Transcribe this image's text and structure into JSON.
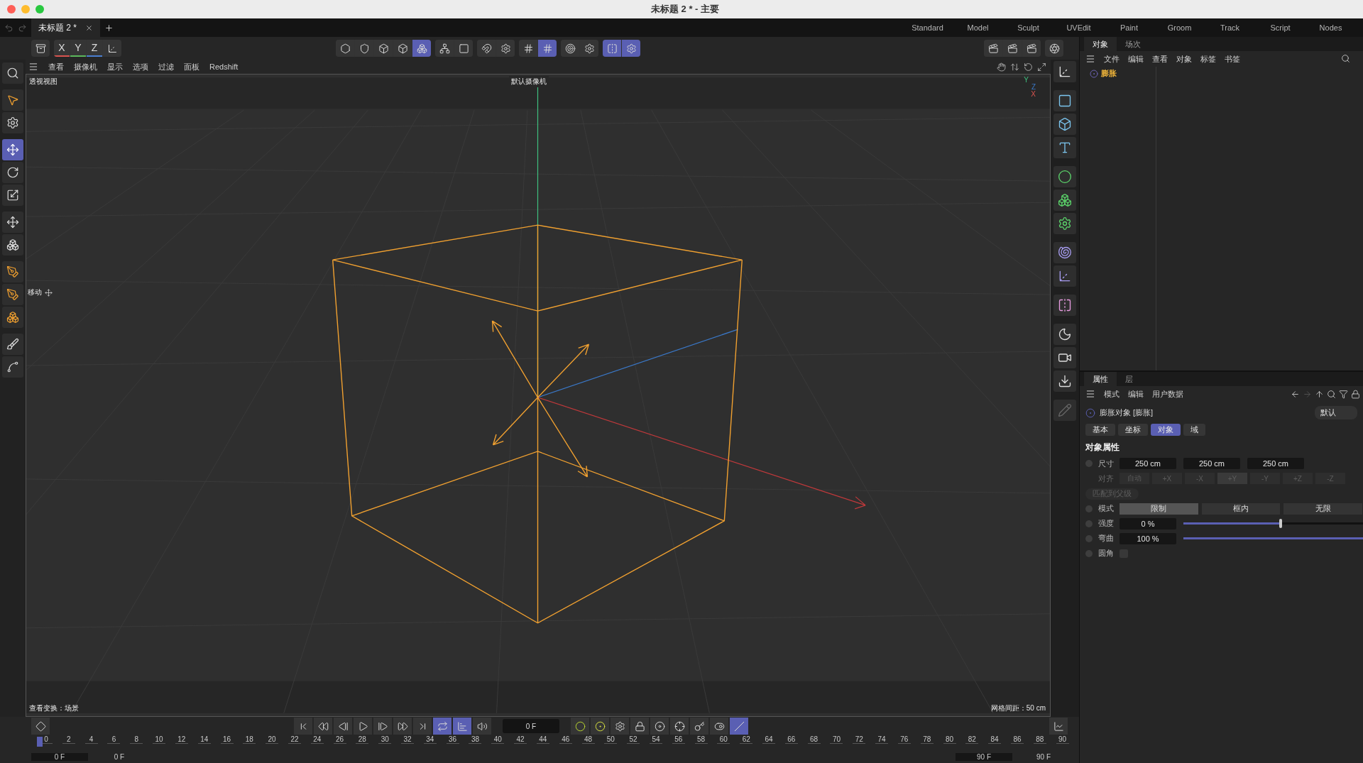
{
  "window": {
    "title": "未标题 2 * - 主要"
  },
  "document_tabs": [
    {
      "label": "未标题 2 *",
      "selected": true
    }
  ],
  "layouts": [
    "Standard",
    "Model",
    "Sculpt",
    "UVEdit",
    "Paint",
    "Groom",
    "Track",
    "Script",
    "Nodes"
  ],
  "toolbar": {
    "axis_buttons": [
      "X",
      "Y",
      "Z"
    ],
    "buttons": [
      {
        "selected": false
      },
      {
        "selected": false
      },
      {
        "selected": false
      },
      {
        "selected": false
      },
      {
        "selected": true
      },
      {
        "selected": false
      },
      {
        "selected": false
      },
      {
        "selected": false
      },
      {
        "selected": false
      },
      {
        "selected": false
      },
      {
        "selected": true
      },
      {
        "selected": false
      },
      {
        "selected": false
      },
      {
        "selected": true
      },
      {
        "selected": true
      }
    ]
  },
  "left_tools": [
    {
      "selected": false
    },
    {
      "selected": false
    },
    {
      "selected": false
    },
    {
      "selected": true
    },
    {
      "selected": false
    },
    {
      "selected": false
    },
    {
      "selected": false
    },
    {
      "selected": false
    },
    {
      "selected": false
    },
    {
      "selected": false
    },
    {
      "selected": false
    },
    {
      "selected": false
    },
    {
      "selected": false
    }
  ],
  "viewport": {
    "menu": [
      "查看",
      "摄像机",
      "显示",
      "选项",
      "过滤",
      "面板",
      "Redshift"
    ],
    "name": "透视视图",
    "camera": "默认摄像机",
    "axis_labels": [
      "Y",
      "Z",
      "X"
    ],
    "tool_label": "移动",
    "status_left": "查看变换：场景",
    "status_right": "网格间距：50 cm"
  },
  "object_manager": {
    "tabs": [
      {
        "label": "对象",
        "selected": true
      },
      {
        "label": "场次",
        "selected": false
      }
    ],
    "menu": [
      "文件",
      "编辑",
      "查看",
      "对象",
      "标签",
      "书签"
    ],
    "objects": [
      {
        "name": "膨胀",
        "selected": true
      }
    ]
  },
  "attributes": {
    "tabs": [
      {
        "label": "属性",
        "selected": true
      },
      {
        "label": "层",
        "selected": false
      }
    ],
    "menu": [
      "模式",
      "编辑",
      "用户数据"
    ],
    "object_title": "膨胀对象 [膨胀]",
    "preset": "默认",
    "section_tabs": [
      {
        "label": "基本",
        "selected": false
      },
      {
        "label": "坐标",
        "selected": false
      },
      {
        "label": "对象",
        "selected": true
      },
      {
        "label": "域",
        "selected": false
      }
    ],
    "section_title": "对象属性",
    "rows": [
      {
        "kind": "vector",
        "label": "尺寸",
        "values": [
          "250 cm",
          "250 cm",
          "250 cm"
        ]
      },
      {
        "kind": "choice",
        "label": "对齐",
        "disabled": true,
        "options": [
          {
            "label": "自动",
            "selected": false
          },
          {
            "label": "+X",
            "selected": false
          },
          {
            "label": "-X",
            "selected": false
          },
          {
            "label": "+Y",
            "selected": true
          },
          {
            "label": "-Y",
            "selected": false
          },
          {
            "label": "+Z",
            "selected": false
          },
          {
            "label": "-Z",
            "selected": false
          }
        ]
      },
      {
        "kind": "button",
        "label": "匹配到父级",
        "disabled": true
      },
      {
        "kind": "segmented",
        "label": "模式",
        "options": [
          {
            "label": "限制",
            "selected": true
          },
          {
            "label": "框内",
            "selected": false
          },
          {
            "label": "无限",
            "selected": false
          }
        ]
      },
      {
        "kind": "slider",
        "label": "强度",
        "value": "0 %",
        "level": 0.55
      },
      {
        "kind": "slider",
        "label": "弯曲",
        "value": "100 %",
        "level": 1
      },
      {
        "kind": "checkbox",
        "label": "圆角",
        "checked": false
      }
    ]
  },
  "timeline": {
    "frame": "0 F",
    "buttons": [
      {
        "selected": false
      },
      {
        "selected": false
      },
      {
        "selected": false
      },
      {
        "selected": false
      },
      {
        "selected": false
      },
      {
        "selected": false
      },
      {
        "selected": false
      },
      {
        "selected": true
      },
      {
        "selected": true
      },
      {
        "selected": false
      },
      {
        "selected": false
      },
      {
        "selected": false
      },
      {
        "selected": false
      },
      {
        "selected": false
      },
      {
        "selected": false
      },
      {
        "selected": false
      },
      {
        "selected": false
      },
      {
        "selected": false
      },
      {
        "selected": true
      }
    ],
    "ruler": [
      "0",
      "2",
      "4",
      "6",
      "8",
      "10",
      "12",
      "14",
      "16",
      "18",
      "20",
      "22",
      "24",
      "26",
      "28",
      "30",
      "32",
      "34",
      "36",
      "38",
      "40",
      "42",
      "44",
      "46",
      "48",
      "50",
      "52",
      "54",
      "56",
      "58",
      "60",
      "62",
      "64",
      "66",
      "68",
      "70",
      "72",
      "74",
      "76",
      "78",
      "80",
      "82",
      "84",
      "86",
      "88",
      "90"
    ],
    "range": [
      "0 F",
      "0 F",
      "90 F",
      "90 F"
    ]
  }
}
